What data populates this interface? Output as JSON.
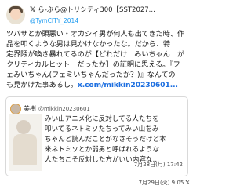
{
  "tweet": {
    "author": {
      "display_name": "ら-ぶら@トリシティ300【SST2027...",
      "handle": "@TymCITY_2014",
      "platform_icon": "x-logo",
      "avatar_icon": "avatar"
    },
    "text_lines": [
      "ツバサとか頭悪い・オカシイ男が何人も出てきた時、作",
      "品を叩くような男は見かけなかったな。だから、特",
      "定界隈が喚き暴れてるのが【どれだけ　みいちゃん　が",
      "クリティカルヒット　だったか】の証明に思える。『フ",
      "ェみいちゃん(フェミいちゃんだったか？)』なんての",
      "も見かけた事あるし。"
    ],
    "link": "x.com/mikkin20230601...",
    "timestamp": "7月29日(火) 9:05",
    "quoted": {
      "display_name": "美樹",
      "handle": "@mikkin20230601",
      "text_lines": [
        "みい山アニメ化に反対してる人たちを",
        "叩いてるネトミソたちってみい山をみ",
        "ちゃんと読んだことがなさそうだけど本",
        "来ネトミソとか弱男と呼ばれるような",
        "人たちこそ反対した方がいい内容な…"
      ],
      "timestamp": "7月28日(月) 17:42"
    }
  },
  "colors": {
    "link": "#1d6fe0",
    "handle": "#1d9bf0",
    "border": "#d9d9d9"
  }
}
